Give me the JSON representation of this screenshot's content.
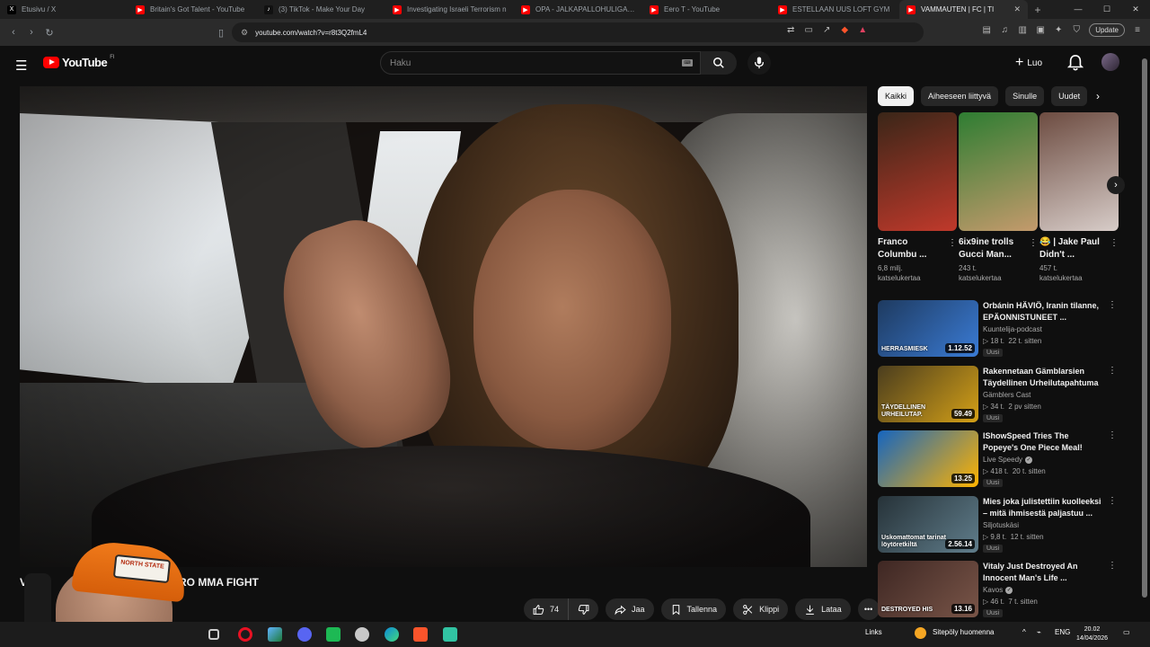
{
  "browser": {
    "tabs": [
      {
        "title": "Etusivu / X",
        "favicon_color": "#000000",
        "favicon_glyph": "X"
      },
      {
        "title": "Britain's Got Talent - YouTube",
        "favicon_color": "#ff0000",
        "favicon_glyph": "▶"
      },
      {
        "title": "(3) TikTok - Make Your Day",
        "favicon_color": "#111111",
        "favicon_glyph": "♪"
      },
      {
        "title": "Investigating Israeli Terrorism n",
        "favicon_color": "#ff0000",
        "favicon_glyph": "▶"
      },
      {
        "title": "OPA - JALKAPALLOHULIGAANI",
        "favicon_color": "#ff0000",
        "favicon_glyph": "▶"
      },
      {
        "title": "Eero T - YouTube",
        "favicon_color": "#ff0000",
        "favicon_glyph": "▶"
      },
      {
        "title": "ESTELLAAN UUS LOFT GYM",
        "favicon_color": "#ff0000",
        "favicon_glyph": "▶"
      },
      {
        "title": "VAMMAUTEN | FC | TI",
        "favicon_color": "#ff0000",
        "favicon_glyph": "▶",
        "active": true
      }
    ],
    "url": "youtube.com/watch?v=r8t3Q2fmL4",
    "update_label": "Update"
  },
  "youtube": {
    "logo_text": "YouTube",
    "country_code": "FI",
    "search_placeholder": "Haku",
    "create_label": "Luo",
    "video_title_start": "VA",
    "video_title_end": "PRO MMA FIGHT",
    "actions": {
      "likes": "74",
      "share": "Jaa",
      "save": "Tallenna",
      "clip": "Klippi",
      "download": "Lataa"
    },
    "chips": [
      "Kaikki",
      "Aiheeseen liittyvä",
      "Sinulle",
      "Uudet"
    ],
    "shorts": [
      {
        "title": "Franco Columbu ...",
        "views": "6,8 milj.",
        "views_label": "katselukertaa",
        "colors": [
          "#3a2618",
          "#c0392b"
        ]
      },
      {
        "title": "6ix9ine trolls Gucci Man...",
        "views": "243 t.",
        "views_label": "katselukertaa",
        "colors": [
          "#2e7d32",
          "#c49a6c"
        ]
      },
      {
        "title": "😂 | Jake Paul Didn't ...",
        "views": "457 t.",
        "views_label": "katselukertaa",
        "colors": [
          "#6d4c41",
          "#d7ccc8"
        ]
      }
    ],
    "recommendations": [
      {
        "title": "Orbánin HÄVIÖ, Iranin tilanne, EPÄONNISTUNEET ...",
        "channel": "Kuuntelija-podcast",
        "views": "18 t.",
        "age": "22 t. sitten",
        "badge": "Uusi",
        "duration": "1.12.52",
        "verified": false,
        "thumb_text": "HERRASMIESK",
        "colors": [
          "#1e3a5f",
          "#3a7bd5"
        ]
      },
      {
        "title": "Rakennetaan Gämblarsien Täydellinen Urheilutapahtuma",
        "channel": "Gämblers Cast",
        "views": "34 t.",
        "age": "2 pv sitten",
        "badge": "Uusi",
        "duration": "59.49",
        "verified": false,
        "thumb_text": "TÄYDELLINEN URHEILUTAP.",
        "colors": [
          "#4a3d1e",
          "#d4a017"
        ]
      },
      {
        "title": "IShowSpeed Tries The Popeye's One Piece Meal!",
        "channel": "Live Speedy",
        "views": "418 t.",
        "age": "20 t. sitten",
        "badge": "Uusi",
        "duration": "13.25",
        "verified": true,
        "thumb_text": "",
        "colors": [
          "#1565c0",
          "#ffb300"
        ]
      },
      {
        "title": "Mies joka julistettiin kuolleeksi – mitä ihmisestä paljastuu ...",
        "channel": "Siljotuskäsi",
        "views": "9,8 t.",
        "age": "12 t. sitten",
        "badge": "Uusi",
        "duration": "2.56.14",
        "verified": false,
        "thumb_text": "Uskomattomat tarinat löytöretkiltä",
        "colors": [
          "#263238",
          "#607d8b"
        ]
      },
      {
        "title": "Vitaly Just Destroyed An Innocent Man's Life ...",
        "channel": "Kavos",
        "views": "46 t.",
        "age": "7 t. sitten",
        "badge": "Uusi",
        "duration": "13.16",
        "verified": true,
        "thumb_text": "DESTROYED HIS",
        "colors": [
          "#3e2723",
          "#795548"
        ]
      }
    ]
  },
  "webcam": {
    "cap_text": "NORTH STATE"
  },
  "taskbar": {
    "links_label": "Links",
    "weather": "Sitepöly huomenna",
    "language": "ENG",
    "time": "20.02",
    "date": "14/04/2026"
  }
}
